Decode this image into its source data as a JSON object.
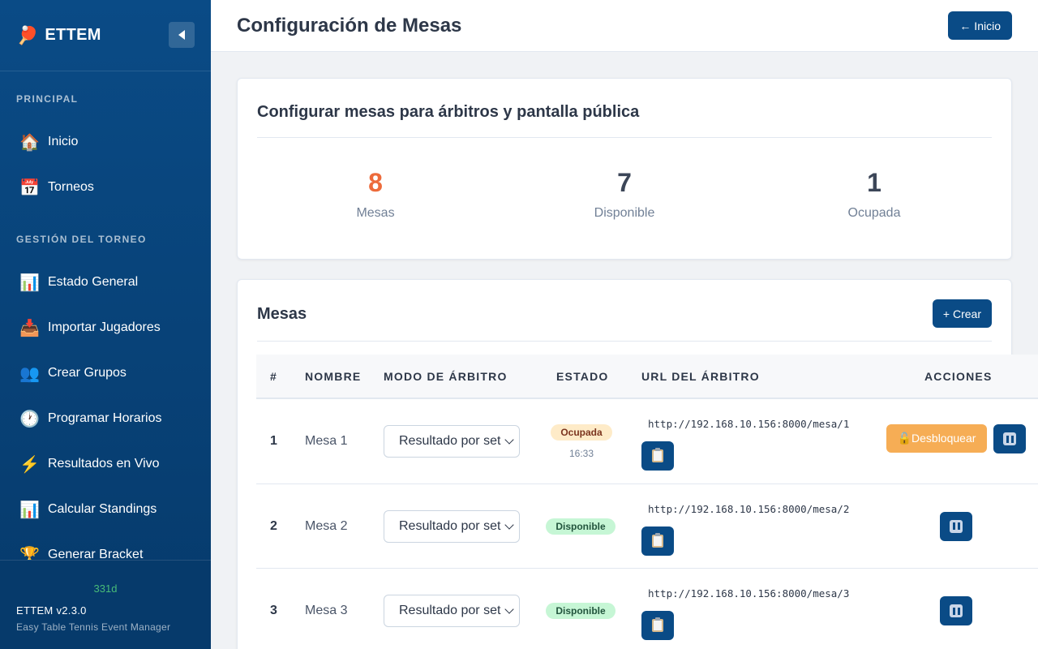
{
  "sidebar": {
    "brand_icon": "🏓",
    "brand_title": "ETTEM",
    "section_principal": "PRINCIPAL",
    "section_gestion": "GESTIÓN DEL TORNEO",
    "items": [
      {
        "icon": "🏠",
        "label": "Inicio"
      },
      {
        "icon": "📅",
        "label": "Torneos"
      },
      {
        "icon": "📊",
        "label": "Estado General"
      },
      {
        "icon": "📥",
        "label": "Importar Jugadores"
      },
      {
        "icon": "👥",
        "label": "Crear Grupos"
      },
      {
        "icon": "🕐",
        "label": "Programar Horarios"
      },
      {
        "icon": "⚡",
        "label": "Resultados en Vivo"
      },
      {
        "icon": "📊",
        "label": "Calcular Standings"
      },
      {
        "icon": "🏆",
        "label": "Generar Bracket"
      }
    ],
    "footer": {
      "badge": "331d",
      "version": "ETTEM v2.3.0",
      "subtitle": "Easy Table Tennis Event Manager"
    }
  },
  "header": {
    "title": "Configuración de Mesas",
    "home_button": "← Inicio"
  },
  "summary": {
    "title": "Configurar mesas para árbitros y pantalla pública",
    "stats": [
      {
        "value": "8",
        "label": "Mesas",
        "color": "#ed6b3b"
      },
      {
        "value": "7",
        "label": "Disponible",
        "color": "#3c4658"
      },
      {
        "value": "1",
        "label": "Ocupada",
        "color": "#3c4658"
      }
    ]
  },
  "tables_card": {
    "title": "Mesas",
    "create_button": "+ Crear",
    "columns": [
      "#",
      "NOMBRE",
      "MODO DE ÁRBITRO",
      "ESTADO",
      "URL DEL ÁRBITRO",
      "ACCIONES"
    ],
    "rows": [
      {
        "num": "1",
        "name": "Mesa 1",
        "mode": "Resultado por set",
        "status": "Ocupada",
        "time": "16:33",
        "url": "http://192.168.10.156:8000/mesa/1",
        "unlock_label": "🔓Desbloquear"
      },
      {
        "num": "2",
        "name": "Mesa 2",
        "mode": "Resultado por set",
        "status": "Disponible",
        "url": "http://192.168.10.156:8000/mesa/2"
      },
      {
        "num": "3",
        "name": "Mesa 3",
        "mode": "Resultado por set",
        "status": "Disponible",
        "url": "http://192.168.10.156:8000/mesa/3"
      }
    ]
  },
  "colors": {
    "primary": "#0a4b86",
    "accent": "#ed6b3b",
    "warning": "#f6ad55",
    "success_bg": "#c6f6d5",
    "busy_bg": "#feebc8"
  }
}
